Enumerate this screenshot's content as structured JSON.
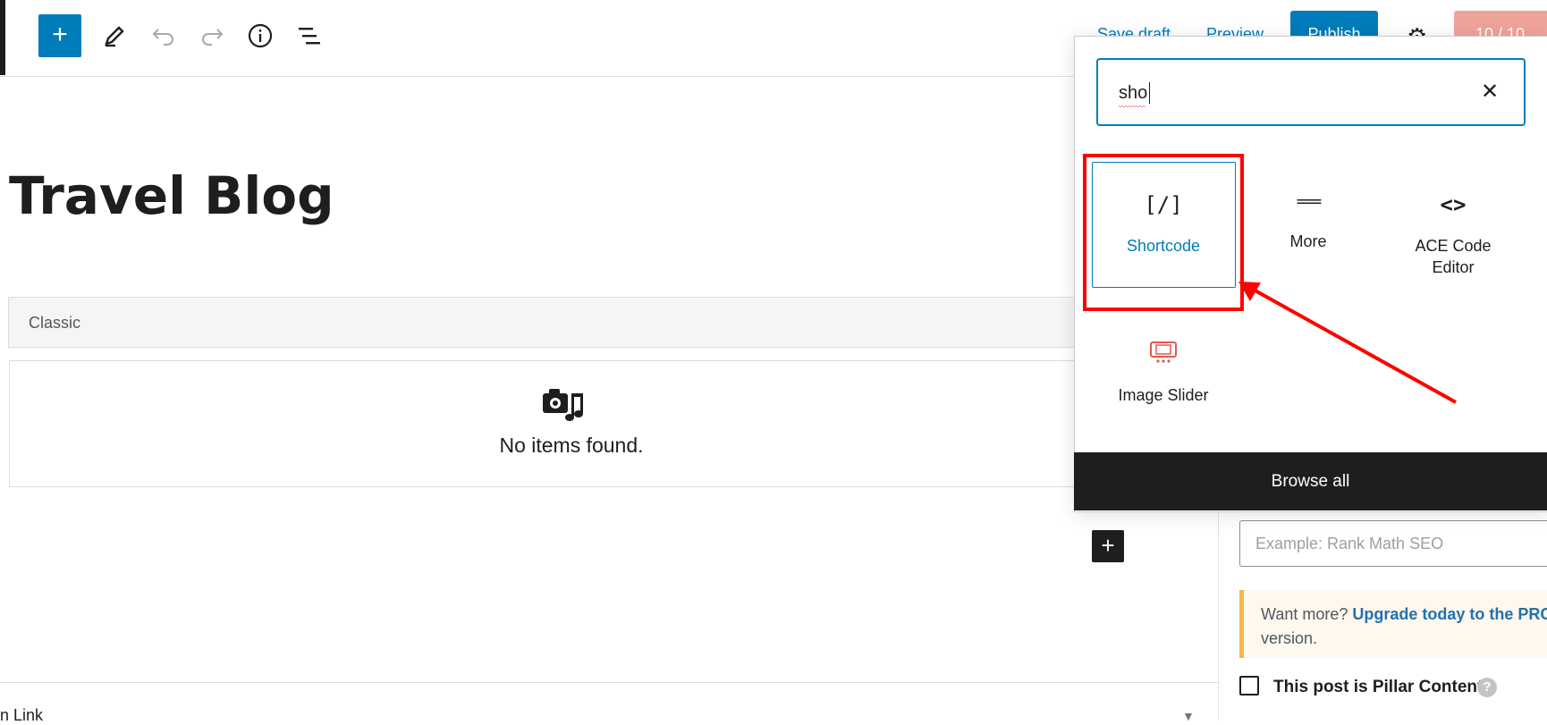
{
  "toolbar": {
    "add_label": "+",
    "save_draft": "Save draft",
    "preview": "Preview",
    "publish": "Publish",
    "score": "10 / 10",
    "icons": [
      "plus-icon",
      "pencil-icon",
      "undo-icon",
      "redo-icon",
      "info-icon",
      "list-view-icon",
      "gear-icon"
    ]
  },
  "editor": {
    "title": "Travel Blog",
    "classic_label": "Classic",
    "no_items": "No items found.",
    "bottom_link": "n Link"
  },
  "inserter": {
    "search_value": "sho",
    "blocks": [
      {
        "label": "Shortcode",
        "icon": "shortcode-icon",
        "glyph": "[/]"
      },
      {
        "label": "More",
        "icon": "more-icon",
        "glyph": "==="
      },
      {
        "label": "ACE Code Editor",
        "icon": "code-icon",
        "glyph": "<>"
      },
      {
        "label": "Image Slider",
        "icon": "slider-icon"
      }
    ],
    "browse_all": "Browse all"
  },
  "sidebar": {
    "input_placeholder": "Example: Rank Math SEO",
    "notice_text": "Want more?",
    "notice_link": "Upgrade today to the PRO",
    "notice_tail": "version.",
    "pillar_label": "This post is Pillar Content",
    "help": "?"
  },
  "colors": {
    "accent": "#007cba",
    "highlight": "#ff0000",
    "dark": "#1e1e1e",
    "slider_icon": "#e15a4e"
  }
}
